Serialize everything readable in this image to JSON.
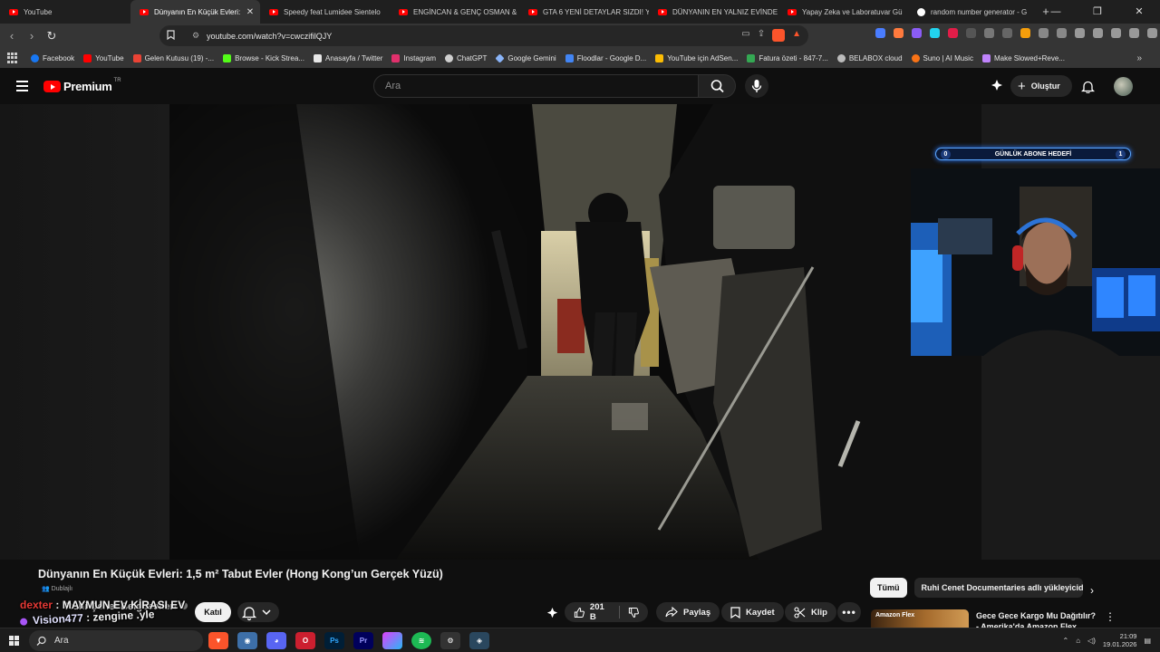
{
  "browser": {
    "tabs": [
      {
        "title": "YouTube",
        "favicon": "youtube-icon",
        "active": false
      },
      {
        "title": "Dünyanın En Küçük Evleri:",
        "favicon": "youtube-icon",
        "active": true
      },
      {
        "title": "Speedy feat Lumidee Sientelo",
        "favicon": "youtube-icon",
        "active": false
      },
      {
        "title": "ENGİNCAN & GENÇ OSMAN &",
        "favicon": "youtube-icon",
        "active": false
      },
      {
        "title": "GTA 6 YENİ DETAYLAR SIZDI! Y",
        "favicon": "youtube-icon",
        "active": false
      },
      {
        "title": "DÜNYANIN EN YALNIZ EVİNDE",
        "favicon": "youtube-icon",
        "active": false
      },
      {
        "title": "Yapay Zeka ve Laboratuvar Gü",
        "favicon": "youtube-icon",
        "active": false
      },
      {
        "title": "random number generator - G",
        "favicon": "google-icon",
        "active": false
      }
    ],
    "new_tab_symbol": "+",
    "url": "youtube.com/watch?v=cwczifilQJY",
    "shield_count": "9",
    "bookmarks": [
      {
        "label": "Facebook",
        "color": "#1877f2"
      },
      {
        "label": "YouTube",
        "color": "#ff0000"
      },
      {
        "label": "Gelen Kutusu (19) -...",
        "color": "#ea4335"
      },
      {
        "label": "Browse - Kick Strea...",
        "color": "#53fc18"
      },
      {
        "label": "Anasayfa / Twitter",
        "color": "#e7e7e7"
      },
      {
        "label": "Instagram",
        "color": "#e1306c"
      },
      {
        "label": "ChatGPT",
        "color": "#cfcfcf"
      },
      {
        "label": "Google Gemini",
        "color": "#8ab4f8"
      },
      {
        "label": "Floodlar - Google D...",
        "color": "#4285f4"
      },
      {
        "label": "YouTube için AdSen...",
        "color": "#fbbc04"
      },
      {
        "label": "Fatura özeti - 847-7...",
        "color": "#34a853"
      },
      {
        "label": "BELABOX cloud",
        "color": "#bbbbbb"
      },
      {
        "label": "Suno | AI Music",
        "color": "#f97316"
      },
      {
        "label": "Make Slowed+Reve...",
        "color": "#c084fc"
      }
    ]
  },
  "youtube": {
    "logo_text": "Premium",
    "region": "TR",
    "search_placeholder": "Ara",
    "create_label": "Oluştur",
    "video": {
      "title": "Dünyanın En Küçük Evleri: 1,5 m² Tabut Evler (Hong Kong’un Gerçek Yüzü)",
      "dubbed_label": "Dublajlı",
      "channel": "Ruhi Çenet Belgeselleri",
      "join_label": "Katıl",
      "likes": "201 B",
      "share_label": "Paylaş",
      "save_label": "Kaydet",
      "clip_label": "Klip"
    },
    "chips": [
      "Tümü",
      "Ruhi Cenet Documentaries adlı yükleyiciden"
    ],
    "recommendation": {
      "title": "Gece Gece Kargo Mu Dağıtılır? - Amerika'da Amazon Flex",
      "thumb_text": "Amazon Flex"
    }
  },
  "stream_overlay": {
    "sub_goal_label": "GÜNLÜK ABONE HEDEFİ",
    "sub_goal_current": "0",
    "sub_goal_target": "1",
    "chat": [
      {
        "user": "dexter",
        "message": "MAYMUN EV KİRASI EV"
      },
      {
        "user": "Vision477",
        "message": "zengine .yle"
      }
    ]
  },
  "taskbar": {
    "search_placeholder": "Ara",
    "time": "21:09",
    "date": "19.01.2026"
  },
  "colors": {
    "youtube_red": "#ff0000",
    "background": "#0f0f0f",
    "goal_glow": "#2f7dff"
  }
}
